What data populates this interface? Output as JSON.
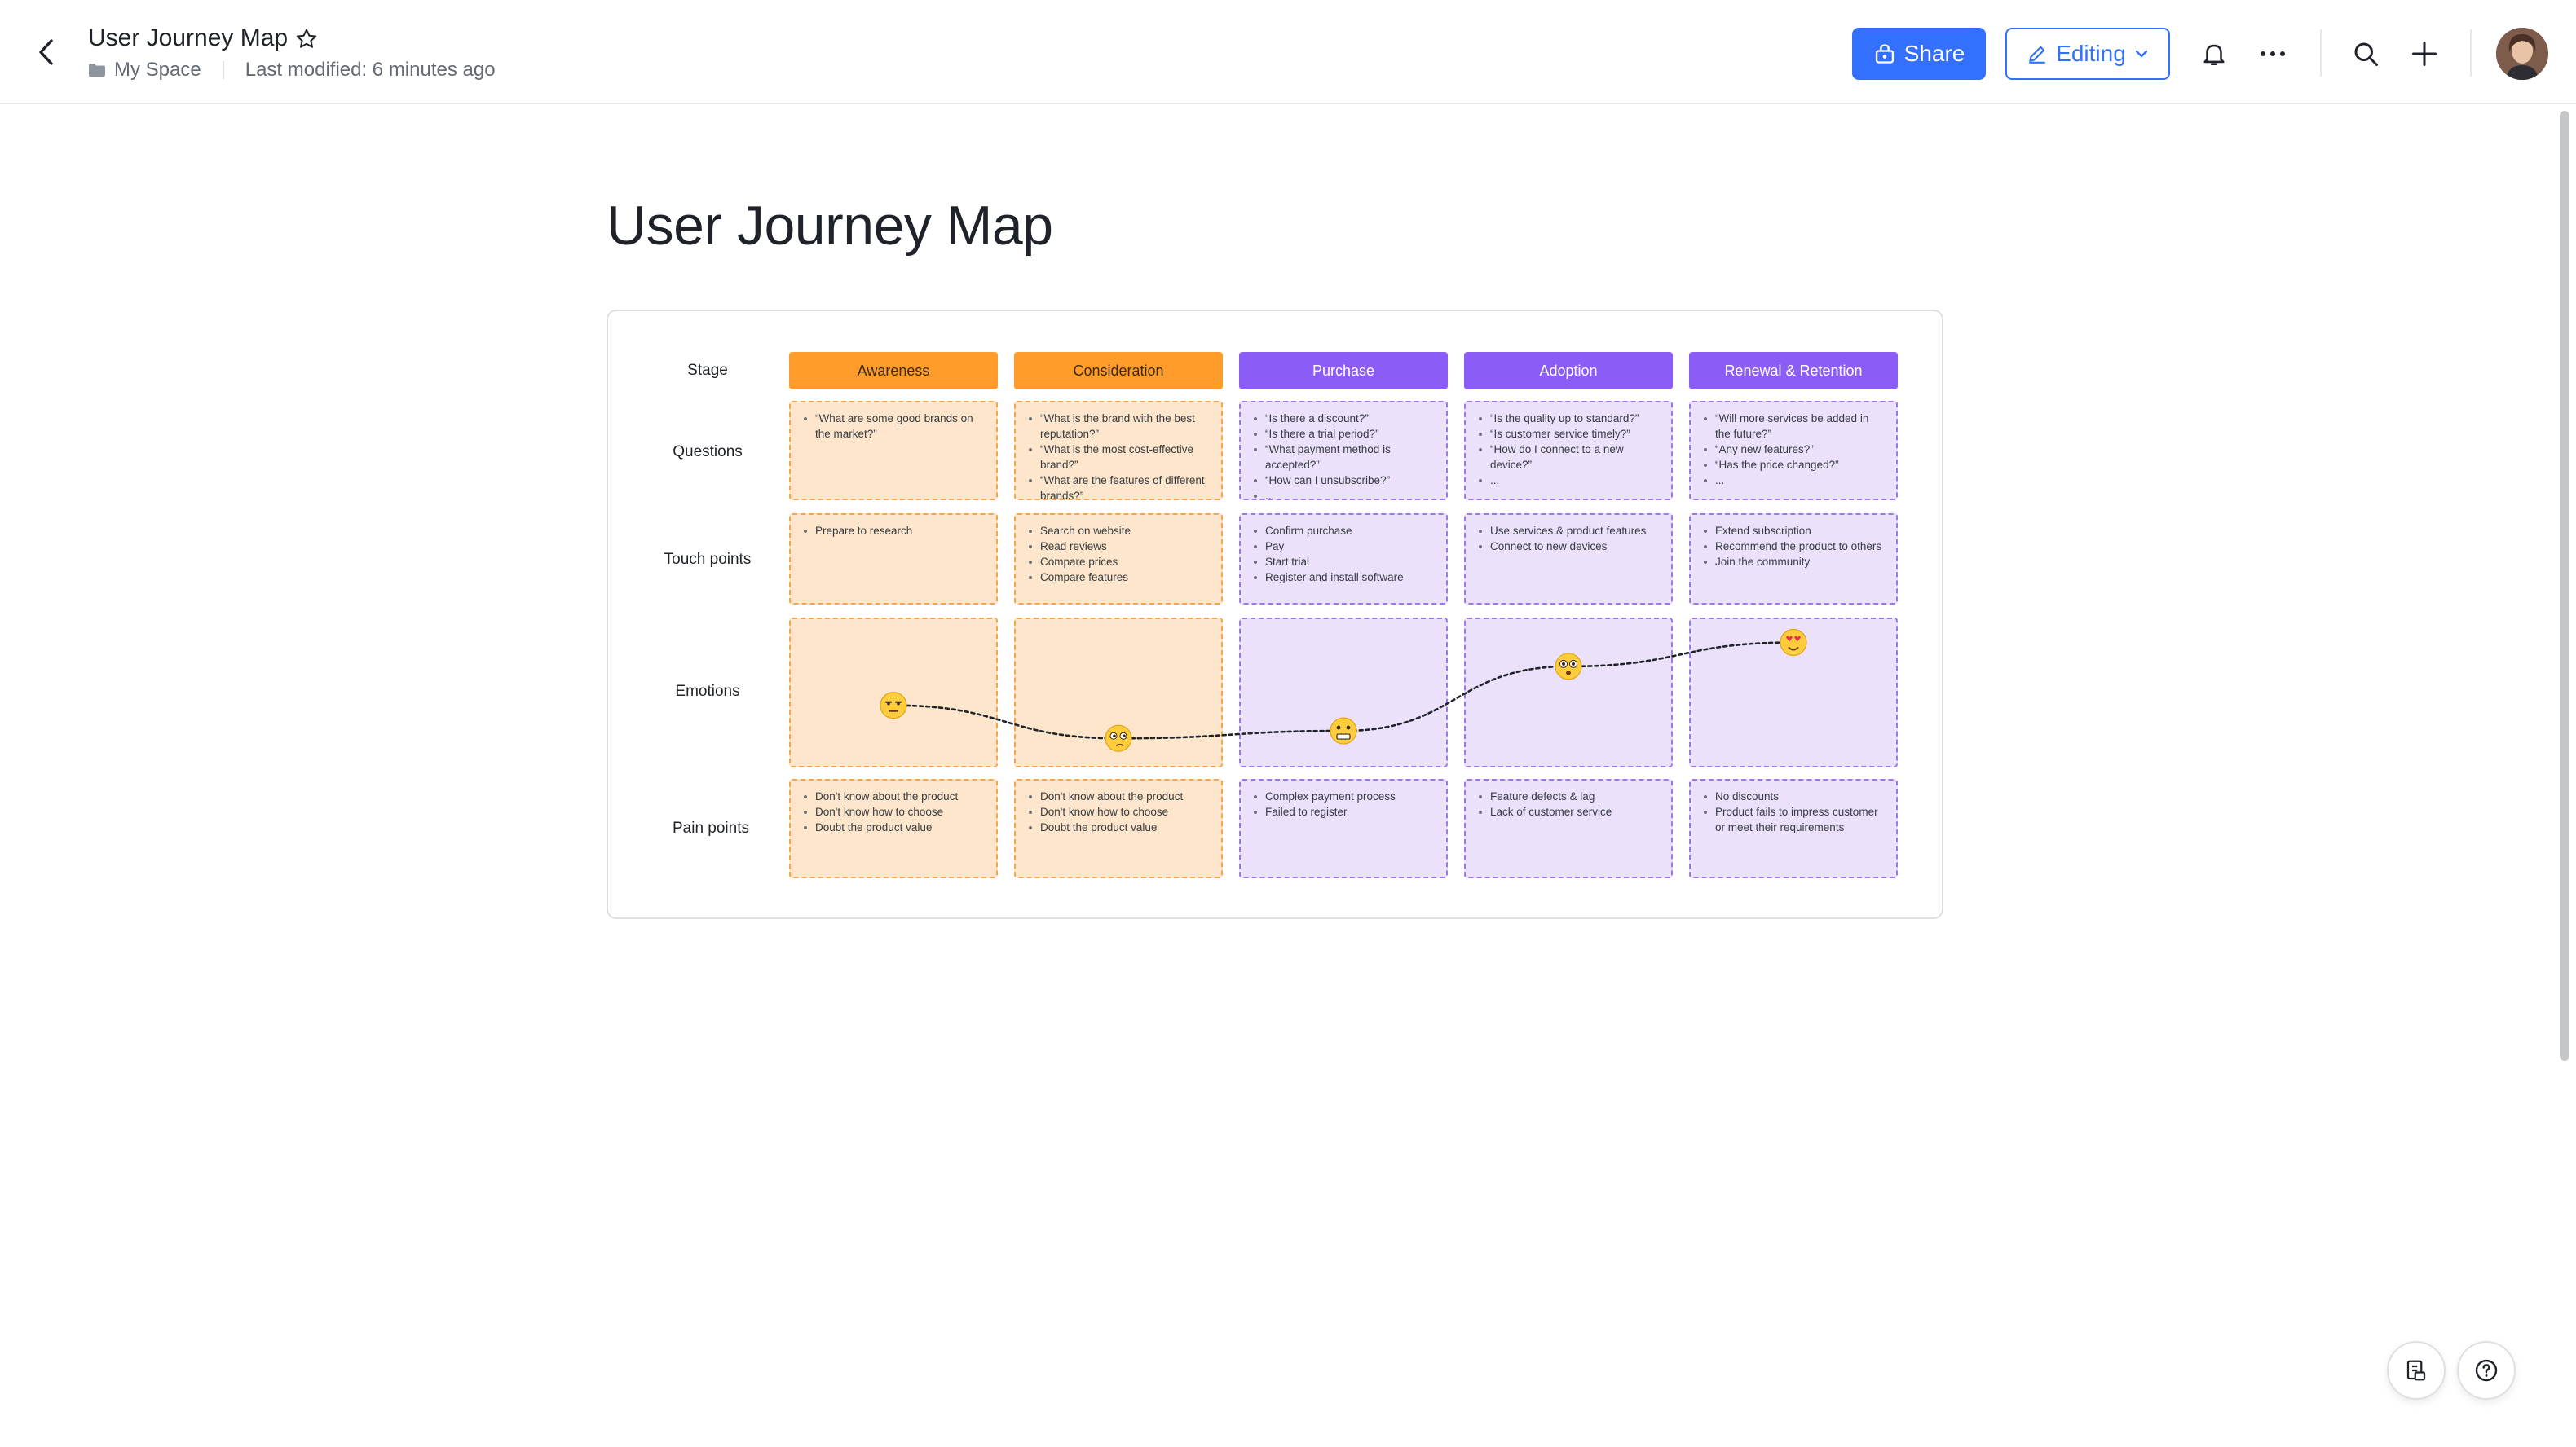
{
  "header": {
    "title": "User Journey Map",
    "location": "My Space",
    "last_modified": "Last modified: 6 minutes ago",
    "share_label": "Share",
    "editing_label": "Editing",
    "accent_color": "#3370ff"
  },
  "page": {
    "title": "User Journey Map"
  },
  "journey_map": {
    "row_labels": {
      "stage": "Stage",
      "questions": "Questions",
      "touch_points": "Touch points",
      "emotions": "Emotions",
      "pain_points": "Pain points"
    },
    "stages": [
      {
        "name": "Awareness",
        "color": "orange",
        "questions": [
          "“What are some good brands on the market?”"
        ],
        "touch_points": [
          "Prepare to research"
        ],
        "emotion_icon": "neutral-face-icon",
        "emotion_level": 0.36,
        "pain_points": [
          "Don't know about the product",
          "Don't know how to choose",
          "Doubt the product value"
        ]
      },
      {
        "name": "Consideration",
        "color": "orange",
        "questions": [
          "“What is the brand with the best reputation?”",
          "“What is the most cost-effective brand?”",
          "“What are the features of different brands?”"
        ],
        "touch_points": [
          "Search on website",
          "Read reviews",
          "Compare prices",
          "Compare features"
        ],
        "emotion_icon": "thinking-face-icon",
        "emotion_level": 0.14,
        "pain_points": [
          "Don't know about the product",
          "Don't know how to choose",
          "Doubt the product value"
        ]
      },
      {
        "name": "Purchase",
        "color": "purple",
        "questions": [
          "“Is there a discount?”",
          "“Is there a trial period?”",
          "“What payment method is accepted?”",
          "“How can I unsubscribe?”",
          "..."
        ],
        "touch_points": [
          "Confirm purchase",
          "Pay",
          "Start trial",
          "Register and install software"
        ],
        "emotion_icon": "grimacing-face-icon",
        "emotion_level": 0.19,
        "pain_points": [
          "Complex payment process",
          "Failed to register"
        ]
      },
      {
        "name": "Adoption",
        "color": "purple",
        "questions": [
          "“Is the quality up to standard?”",
          "“Is customer service timely?”",
          "“How do I connect to a new device?”",
          "..."
        ],
        "touch_points": [
          "Use services & product features",
          "Connect to new devices"
        ],
        "emotion_icon": "pleased-face-icon",
        "emotion_level": 0.62,
        "pain_points": [
          "Feature defects & lag",
          "Lack of customer service"
        ]
      },
      {
        "name": "Renewal & Retention",
        "color": "purple",
        "questions": [
          "“Will more services be added in the future?”",
          "“Any new features?”",
          "“Has the price changed?”",
          "..."
        ],
        "touch_points": [
          "Extend subscription",
          "Recommend the product to others",
          "Join the community"
        ],
        "emotion_icon": "heart-eyes-face-icon",
        "emotion_level": 0.78,
        "pain_points": [
          "No discounts",
          "Product fails to impress customer or meet their requirements"
        ]
      }
    ],
    "colors": {
      "orange_header": "#ff9c2a",
      "orange_cell": "#fde6cb",
      "purple_header": "#8b5cf6",
      "purple_cell": "#ebe1fb"
    }
  }
}
